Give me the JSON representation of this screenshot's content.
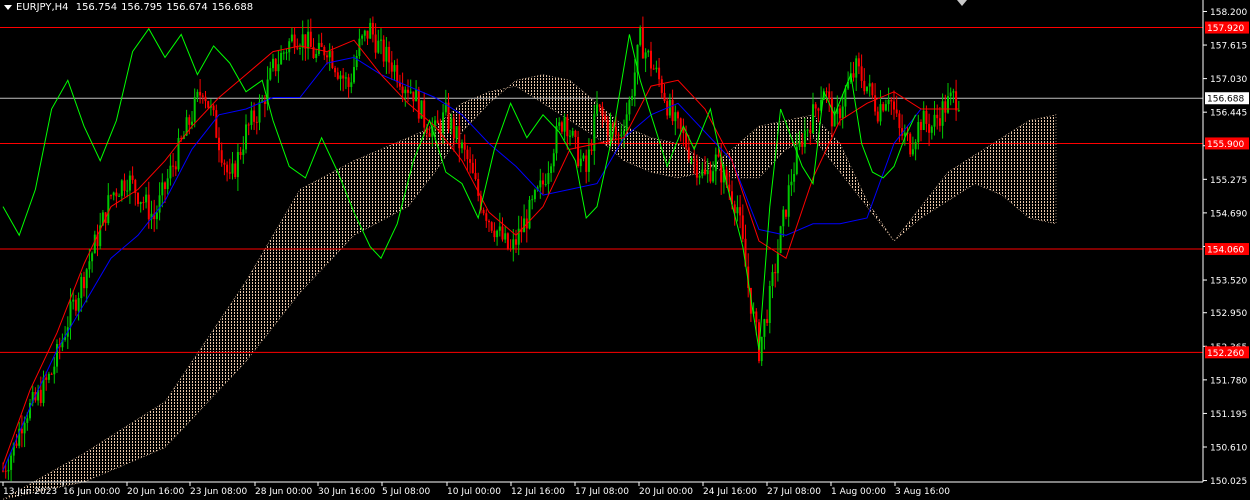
{
  "header": {
    "symbol": "EURJPY,H4",
    "open": "156.754",
    "high": "156.795",
    "low": "156.674",
    "close": "156.688"
  },
  "colors": {
    "background": "#000000",
    "bull": "#00c800",
    "bear": "#ff0000",
    "kijun": "#0000ff",
    "tenkan": "#ff0000",
    "chikou": "#00ff00",
    "cloud": "#ffdab9",
    "level_line": "#ff0000",
    "current_price_line": "#c0c0c0",
    "axis_text": "#ffffff"
  },
  "chart_data": {
    "type": "candlestick",
    "symbol": "EURJPY",
    "timeframe": "H4",
    "indicators": [
      "Ichimoku Kinko Hyo"
    ],
    "ylim": [
      150.0,
      158.4
    ],
    "y_ticks": [
      "158.200",
      "157.615",
      "157.030",
      "156.445",
      "155.860",
      "155.275",
      "154.690",
      "154.105",
      "153.520",
      "152.950",
      "152.365",
      "151.780",
      "151.195",
      "150.610",
      "150.025"
    ],
    "x_ticks": [
      "13 Jun 2023",
      "16 Jun 00:00",
      "20 Jun 16:00",
      "23 Jun 08:00",
      "28 Jun 00:00",
      "30 Jun 16:00",
      "5 Jul 08:00",
      "10 Jul 00:00",
      "12 Jul 16:00",
      "17 Jul 08:00",
      "20 Jul 00:00",
      "24 Jul 16:00",
      "27 Jul 08:00",
      "1 Aug 00:00",
      "3 Aug 16:00"
    ],
    "horizontal_levels": [
      {
        "label": "157.920",
        "value": 157.92
      },
      {
        "label": "155.900",
        "value": 155.9
      },
      {
        "label": "154.060",
        "value": 154.06
      },
      {
        "label": "152.260",
        "value": 152.26
      }
    ],
    "current_price": {
      "label": "156.688",
      "value": 156.688
    },
    "price_path": [
      [
        0,
        150.2
      ],
      [
        4,
        150.6
      ],
      [
        8,
        151.2
      ],
      [
        12,
        151.4
      ],
      [
        18,
        151.9
      ],
      [
        24,
        152.8
      ],
      [
        30,
        153.6
      ],
      [
        36,
        154.4
      ],
      [
        40,
        155.0
      ],
      [
        46,
        155.3
      ],
      [
        52,
        154.9
      ],
      [
        56,
        154.6
      ],
      [
        62,
        155.4
      ],
      [
        66,
        155.9
      ],
      [
        70,
        156.4
      ],
      [
        74,
        156.9
      ],
      [
        78,
        156.3
      ],
      [
        82,
        155.6
      ],
      [
        84,
        155.2
      ],
      [
        90,
        156.1
      ],
      [
        96,
        156.6
      ],
      [
        100,
        157.2
      ],
      [
        104,
        157.5
      ],
      [
        108,
        157.8
      ],
      [
        112,
        157.7
      ],
      [
        116,
        157.4
      ],
      [
        120,
        157.6
      ],
      [
        124,
        157.2
      ],
      [
        128,
        156.9
      ],
      [
        132,
        157.6
      ],
      [
        136,
        157.9
      ],
      [
        140,
        157.5
      ],
      [
        144,
        157.3
      ],
      [
        148,
        157.0
      ],
      [
        152,
        156.8
      ],
      [
        156,
        156.3
      ],
      [
        160,
        156.1
      ],
      [
        164,
        156.4
      ],
      [
        168,
        156.0
      ],
      [
        172,
        155.6
      ],
      [
        176,
        155.0
      ],
      [
        180,
        154.6
      ],
      [
        184,
        154.3
      ],
      [
        188,
        154.0
      ],
      [
        192,
        154.4
      ],
      [
        196,
        154.8
      ],
      [
        200,
        155.2
      ],
      [
        204,
        155.9
      ],
      [
        208,
        156.4
      ],
      [
        212,
        155.8
      ],
      [
        216,
        155.4
      ],
      [
        220,
        156.5
      ],
      [
        224,
        156.2
      ],
      [
        228,
        156.0
      ],
      [
        232,
        156.6
      ],
      [
        236,
        157.7
      ],
      [
        240,
        157.3
      ],
      [
        244,
        156.9
      ],
      [
        248,
        156.3
      ],
      [
        252,
        156.0
      ],
      [
        256,
        155.6
      ],
      [
        260,
        155.3
      ],
      [
        264,
        155.6
      ],
      [
        268,
        155.2
      ],
      [
        272,
        154.8
      ],
      [
        276,
        153.4
      ],
      [
        280,
        152.3
      ],
      [
        284,
        153.2
      ],
      [
        288,
        154.3
      ],
      [
        292,
        155.3
      ],
      [
        296,
        156.0
      ],
      [
        300,
        156.4
      ],
      [
        304,
        156.9
      ],
      [
        308,
        156.2
      ],
      [
        312,
        156.8
      ],
      [
        316,
        157.2
      ],
      [
        320,
        156.9
      ],
      [
        324,
        156.5
      ],
      [
        328,
        156.8
      ],
      [
        332,
        156.1
      ],
      [
        336,
        155.9
      ],
      [
        340,
        156.3
      ],
      [
        344,
        156.2
      ],
      [
        348,
        156.5
      ],
      [
        352,
        156.7
      ],
      [
        354,
        156.69
      ]
    ],
    "kijun_path": [
      [
        0,
        150.2
      ],
      [
        10,
        151.3
      ],
      [
        20,
        152.3
      ],
      [
        30,
        153.1
      ],
      [
        40,
        153.9
      ],
      [
        50,
        154.3
      ],
      [
        60,
        154.9
      ],
      [
        70,
        155.8
      ],
      [
        80,
        156.4
      ],
      [
        90,
        156.5
      ],
      [
        100,
        156.7
      ],
      [
        110,
        156.7
      ],
      [
        120,
        157.3
      ],
      [
        130,
        157.4
      ],
      [
        140,
        157.1
      ],
      [
        150,
        156.9
      ],
      [
        160,
        156.7
      ],
      [
        170,
        156.4
      ],
      [
        180,
        155.9
      ],
      [
        190,
        155.5
      ],
      [
        200,
        155.0
      ],
      [
        210,
        155.1
      ],
      [
        220,
        155.2
      ],
      [
        230,
        156.0
      ],
      [
        240,
        156.4
      ],
      [
        250,
        156.6
      ],
      [
        260,
        156.1
      ],
      [
        270,
        155.6
      ],
      [
        280,
        154.4
      ],
      [
        290,
        154.3
      ],
      [
        300,
        154.5
      ],
      [
        310,
        154.5
      ],
      [
        320,
        154.6
      ],
      [
        330,
        155.9
      ],
      [
        340,
        156.5
      ],
      [
        354,
        156.5
      ]
    ],
    "tenkan_path": [
      [
        0,
        150.3
      ],
      [
        10,
        151.6
      ],
      [
        20,
        152.6
      ],
      [
        30,
        153.8
      ],
      [
        40,
        154.8
      ],
      [
        50,
        155.1
      ],
      [
        60,
        155.6
      ],
      [
        70,
        156.2
      ],
      [
        80,
        156.7
      ],
      [
        90,
        157.1
      ],
      [
        100,
        157.5
      ],
      [
        110,
        157.6
      ],
      [
        120,
        157.5
      ],
      [
        130,
        157.7
      ],
      [
        140,
        157.1
      ],
      [
        150,
        156.6
      ],
      [
        160,
        156.2
      ],
      [
        170,
        155.6
      ],
      [
        180,
        154.7
      ],
      [
        190,
        154.3
      ],
      [
        200,
        154.8
      ],
      [
        210,
        155.8
      ],
      [
        220,
        155.9
      ],
      [
        230,
        156.0
      ],
      [
        240,
        156.9
      ],
      [
        250,
        157.0
      ],
      [
        260,
        156.5
      ],
      [
        270,
        155.6
      ],
      [
        280,
        154.2
      ],
      [
        290,
        153.9
      ],
      [
        300,
        155.3
      ],
      [
        310,
        156.3
      ],
      [
        320,
        156.6
      ],
      [
        330,
        156.8
      ],
      [
        340,
        156.5
      ],
      [
        354,
        156.5
      ]
    ],
    "chikou_path": [
      [
        0,
        154.8
      ],
      [
        6,
        154.3
      ],
      [
        12,
        155.1
      ],
      [
        18,
        156.5
      ],
      [
        24,
        157.0
      ],
      [
        30,
        156.2
      ],
      [
        36,
        155.6
      ],
      [
        42,
        156.3
      ],
      [
        48,
        157.5
      ],
      [
        54,
        157.9
      ],
      [
        60,
        157.4
      ],
      [
        66,
        157.8
      ],
      [
        72,
        157.1
      ],
      [
        78,
        157.6
      ],
      [
        84,
        157.3
      ],
      [
        90,
        156.8
      ],
      [
        96,
        157.0
      ],
      [
        100,
        156.3
      ],
      [
        106,
        155.5
      ],
      [
        112,
        155.3
      ],
      [
        118,
        156.0
      ],
      [
        124,
        155.4
      ],
      [
        130,
        154.7
      ],
      [
        136,
        154.1
      ],
      [
        140,
        153.9
      ],
      [
        146,
        154.5
      ],
      [
        152,
        155.6
      ],
      [
        158,
        156.3
      ],
      [
        164,
        155.4
      ],
      [
        170,
        155.2
      ],
      [
        176,
        154.6
      ],
      [
        182,
        155.8
      ],
      [
        188,
        156.6
      ],
      [
        194,
        156.0
      ],
      [
        200,
        156.4
      ],
      [
        206,
        156.1
      ],
      [
        212,
        155.6
      ],
      [
        216,
        154.6
      ],
      [
        220,
        154.8
      ],
      [
        226,
        156.1
      ],
      [
        232,
        157.8
      ],
      [
        236,
        157.0
      ],
      [
        240,
        156.4
      ],
      [
        246,
        155.5
      ],
      [
        252,
        156.2
      ],
      [
        256,
        155.8
      ],
      [
        262,
        156.5
      ],
      [
        268,
        155.2
      ],
      [
        274,
        154.1
      ],
      [
        280,
        152.3
      ],
      [
        284,
        154.8
      ],
      [
        288,
        156.5
      ],
      [
        292,
        156.0
      ],
      [
        296,
        155.5
      ],
      [
        300,
        155.2
      ],
      [
        304,
        156.8
      ],
      [
        308,
        156.4
      ],
      [
        314,
        157.1
      ],
      [
        318,
        155.9
      ],
      [
        322,
        155.4
      ],
      [
        326,
        155.3
      ],
      [
        330,
        155.5
      ],
      [
        334,
        156.0
      ],
      [
        338,
        156.4
      ]
    ],
    "cloud_span_a": [
      [
        0,
        149.7
      ],
      [
        30,
        150.5
      ],
      [
        60,
        151.4
      ],
      [
        90,
        153.5
      ],
      [
        110,
        155.1
      ],
      [
        130,
        155.6
      ],
      [
        150,
        156.0
      ],
      [
        160,
        156.2
      ],
      [
        170,
        156.6
      ],
      [
        180,
        156.8
      ],
      [
        190,
        156.9
      ],
      [
        200,
        156.6
      ],
      [
        210,
        156.3
      ],
      [
        220,
        156.0
      ],
      [
        230,
        155.6
      ],
      [
        240,
        155.4
      ],
      [
        250,
        155.3
      ],
      [
        260,
        155.4
      ],
      [
        270,
        155.8
      ],
      [
        280,
        156.2
      ],
      [
        290,
        156.3
      ],
      [
        300,
        156.4
      ],
      [
        310,
        155.9
      ],
      [
        320,
        154.9
      ],
      [
        330,
        154.2
      ],
      [
        340,
        154.8
      ],
      [
        350,
        155.4
      ],
      [
        360,
        155.7
      ],
      [
        370,
        156.0
      ],
      [
        380,
        156.3
      ],
      [
        390,
        156.4
      ]
    ],
    "cloud_span_b": [
      [
        0,
        149.7
      ],
      [
        30,
        150.0
      ],
      [
        60,
        150.6
      ],
      [
        90,
        152.1
      ],
      [
        110,
        153.3
      ],
      [
        130,
        154.3
      ],
      [
        150,
        154.8
      ],
      [
        160,
        155.4
      ],
      [
        170,
        156.1
      ],
      [
        180,
        156.6
      ],
      [
        190,
        157.0
      ],
      [
        200,
        157.1
      ],
      [
        210,
        157.0
      ],
      [
        220,
        156.6
      ],
      [
        230,
        156.2
      ],
      [
        240,
        156.0
      ],
      [
        250,
        155.9
      ],
      [
        260,
        155.6
      ],
      [
        270,
        155.3
      ],
      [
        280,
        155.3
      ],
      [
        290,
        155.8
      ],
      [
        300,
        156.0
      ],
      [
        310,
        155.4
      ],
      [
        320,
        154.8
      ],
      [
        330,
        154.2
      ],
      [
        340,
        154.6
      ],
      [
        350,
        154.9
      ],
      [
        360,
        155.2
      ],
      [
        370,
        155.0
      ],
      [
        380,
        154.6
      ],
      [
        390,
        154.5
      ]
    ]
  }
}
